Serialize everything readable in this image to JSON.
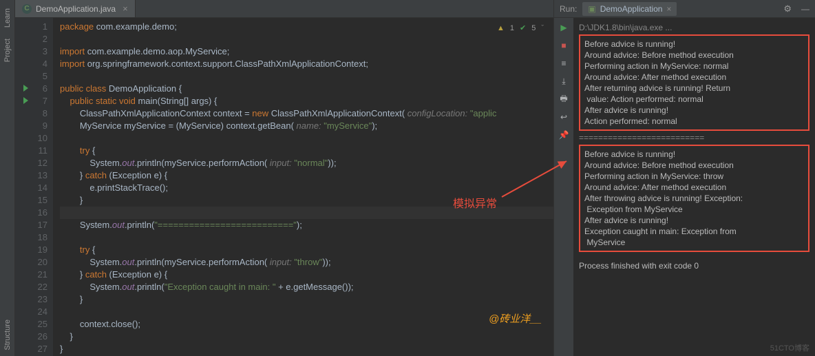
{
  "sidebar_left": {
    "tabs": [
      "Learn",
      "Project",
      "Structure"
    ]
  },
  "tabbar": {
    "file_tab": "DemoApplication.java"
  },
  "inspection": {
    "warn_count": "1",
    "info_count": "5"
  },
  "gutter_lines": 27,
  "code_lines": [
    {
      "n": 1,
      "html": "<span class='kw'>package</span> com.example.demo;"
    },
    {
      "n": 2,
      "html": ""
    },
    {
      "n": 3,
      "html": "<span class='kw'>import</span> com.example.demo.aop.MyService;"
    },
    {
      "n": 4,
      "html": "<span class='kw'>import</span> org.springframework.context.support.ClassPathXmlApplicationContext;"
    },
    {
      "n": 5,
      "html": ""
    },
    {
      "n": 6,
      "html": "<span class='kw'>public class</span> DemoApplication {",
      "run": true
    },
    {
      "n": 7,
      "html": "    <span class='kw'>public static void</span> main(String[] args) {",
      "run": true
    },
    {
      "n": 8,
      "html": "        ClassPathXmlApplicationContext context = <span class='kw'>new</span> ClassPathXmlApplicationContext( <span class='hint'>configLocation:</span> <span class='str'>\"applic</span>"
    },
    {
      "n": 9,
      "html": "        MyService myService = (MyService) context.getBean( <span class='hint'>name:</span> <span class='str'>\"myService\"</span>);"
    },
    {
      "n": 10,
      "html": ""
    },
    {
      "n": 11,
      "html": "        <span class='kw'>try</span> {"
    },
    {
      "n": 12,
      "html": "            System.<span class='fld'>out</span>.println(myService.performAction( <span class='hint'>input:</span> <span class='str'>\"normal\"</span>));"
    },
    {
      "n": 13,
      "html": "        } <span class='kw'>catch</span> (Exception e) {"
    },
    {
      "n": 14,
      "html": "            e.printStackTrace();"
    },
    {
      "n": 15,
      "html": "        }"
    },
    {
      "n": 16,
      "html": "",
      "hl": true
    },
    {
      "n": 17,
      "html": "        System.<span class='fld'>out</span>.println(<span class='str'>\"==========================\"</span>);"
    },
    {
      "n": 18,
      "html": ""
    },
    {
      "n": 19,
      "html": "        <span class='kw'>try</span> {"
    },
    {
      "n": 20,
      "html": "            System.<span class='fld'>out</span>.println(myService.performAction( <span class='hint'>input:</span> <span class='str'>\"throw\"</span>));"
    },
    {
      "n": 21,
      "html": "        } <span class='kw'>catch</span> (Exception e) {"
    },
    {
      "n": 22,
      "html": "            System.<span class='fld'>out</span>.println(<span class='str'>\"Exception caught in main: \"</span> + e.getMessage());"
    },
    {
      "n": 23,
      "html": "        }"
    },
    {
      "n": 24,
      "html": ""
    },
    {
      "n": 25,
      "html": "        context.close();"
    },
    {
      "n": 26,
      "html": "    }"
    },
    {
      "n": 27,
      "html": "}"
    }
  ],
  "run": {
    "label": "Run:",
    "config_name": "DemoApplication",
    "cmd": "D:\\JDK1.8\\bin\\java.exe ...",
    "block1": [
      "Before advice is running!",
      "Around advice: Before method execution",
      "Performing action in MyService: normal",
      "Around advice: After method execution",
      "After returning advice is running! Return",
      " value: Action performed: normal",
      "After advice is running!",
      "Action performed: normal"
    ],
    "sep": "==========================",
    "block2": [
      "Before advice is running!",
      "Around advice: Before method execution",
      "Performing action in MyService: throw",
      "Around advice: After method execution",
      "After throwing advice is running! Exception:",
      " Exception from MyService",
      "After advice is running!",
      "Exception caught in main: Exception from ",
      " MyService"
    ],
    "exit": "Process finished with exit code 0"
  },
  "annotations": {
    "red": "模拟异常",
    "yellow": "@砖业洋__"
  },
  "watermark": "51CTO博客"
}
